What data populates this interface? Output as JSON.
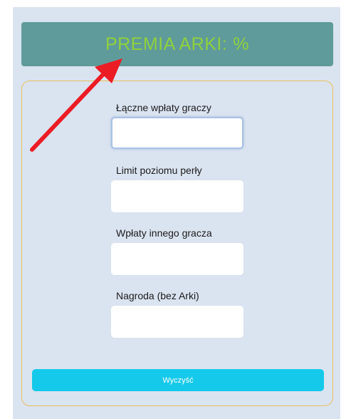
{
  "header": {
    "title": "PREMIA ARKI:",
    "value": "",
    "unit": "%",
    "text_color": "#8fd13d",
    "background_color": "#5f9b9a"
  },
  "form": {
    "fields": [
      {
        "label": "Łączne wpłaty graczy",
        "value": "",
        "focused": true
      },
      {
        "label": "Limit poziomu perły",
        "value": "",
        "focused": false
      },
      {
        "label": "Wpłaty innego gracza",
        "value": "",
        "focused": false
      },
      {
        "label": "Nagroda (bez Arki)",
        "value": "",
        "focused": false
      }
    ],
    "clear_label": "Wyczyść",
    "accent_color": "#15c9ea",
    "border_color": "#e8c15a"
  },
  "annotation": {
    "icon": "red-arrow-icon",
    "color": "#ec1c24"
  }
}
